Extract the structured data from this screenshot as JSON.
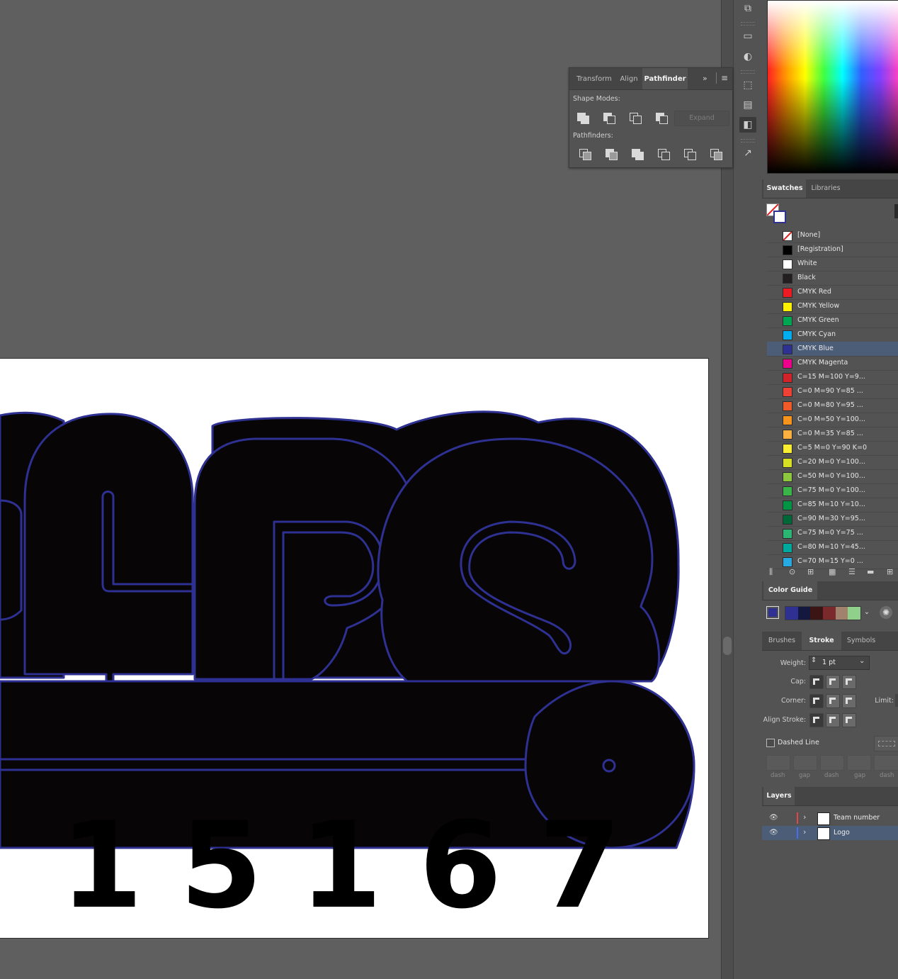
{
  "pathfinder_panel": {
    "tabs": [
      "Transform",
      "Align",
      "Pathfinder"
    ],
    "active_tab": "Pathfinder",
    "shape_modes_label": "Shape Modes:",
    "pathfinders_label": "Pathfinders:",
    "expand_label": "Expand"
  },
  "swatches_panel": {
    "tabs": [
      "Swatches",
      "Libraries"
    ],
    "items": [
      {
        "name": "[None]",
        "color": "#ffffff"
      },
      {
        "name": "[Registration]",
        "color": "#000000"
      },
      {
        "name": "White",
        "color": "#ffffff"
      },
      {
        "name": "Black",
        "color": "#231f20"
      },
      {
        "name": "CMYK Red",
        "color": "#ed1c24"
      },
      {
        "name": "CMYK Yellow",
        "color": "#fff200"
      },
      {
        "name": "CMYK Green",
        "color": "#00a651"
      },
      {
        "name": "CMYK Cyan",
        "color": "#00aeef"
      },
      {
        "name": "CMYK Blue",
        "color": "#2e3192"
      },
      {
        "name": "CMYK Magenta",
        "color": "#ec008c"
      },
      {
        "name": "C=15 M=100 Y=9...",
        "color": "#d2232a"
      },
      {
        "name": "C=0 M=90 Y=85 ...",
        "color": "#ef4136"
      },
      {
        "name": "C=0 M=80 Y=95 ...",
        "color": "#f15a29"
      },
      {
        "name": "C=0 M=50 Y=100...",
        "color": "#f7941d"
      },
      {
        "name": "C=0 M=35 Y=85 ...",
        "color": "#fbb040"
      },
      {
        "name": "C=5 M=0 Y=90 K=0",
        "color": "#f9ed32"
      },
      {
        "name": "C=20 M=0 Y=100...",
        "color": "#d7df23"
      },
      {
        "name": "C=50 M=0 Y=100...",
        "color": "#8dc63f"
      },
      {
        "name": "C=75 M=0 Y=100...",
        "color": "#39b54a"
      },
      {
        "name": "C=85 M=10 Y=10...",
        "color": "#009444"
      },
      {
        "name": "C=90 M=30 Y=95...",
        "color": "#006838"
      },
      {
        "name": "C=75 M=0 Y=75 ...",
        "color": "#2bb673"
      },
      {
        "name": "C=80 M=10 Y=45...",
        "color": "#00a99d"
      },
      {
        "name": "C=70 M=15 Y=0 ...",
        "color": "#27aae1"
      }
    ],
    "selected": "CMYK Blue"
  },
  "color_guide": {
    "title": "Color Guide",
    "base_color": "#2e3192",
    "harmony": [
      "#2e3192",
      "#14183f",
      "#3b1414",
      "#7a2a2a",
      "#a0826d",
      "#8fd18a"
    ]
  },
  "stroke_panel": {
    "tabs": [
      "Brushes",
      "Stroke",
      "Symbols"
    ],
    "active_tab": "Stroke",
    "weight_label": "Weight:",
    "weight_value": "1 pt",
    "cap_label": "Cap:",
    "corner_label": "Corner:",
    "limit_label": "Limit:",
    "align_label": "Align Stroke:",
    "dashed_label": "Dashed Line",
    "dash_labels": [
      "dash",
      "gap",
      "dash",
      "gap",
      "dash"
    ]
  },
  "layers_panel": {
    "title": "Layers",
    "layers": [
      {
        "name": "Team number",
        "color": "#e04848"
      },
      {
        "name": "Logo",
        "color": "#4a6cf0"
      }
    ],
    "selected": "Logo"
  },
  "artwork": {
    "team_number": "15167",
    "stroke_color": "#2e3192",
    "fill_color": "#070505"
  }
}
